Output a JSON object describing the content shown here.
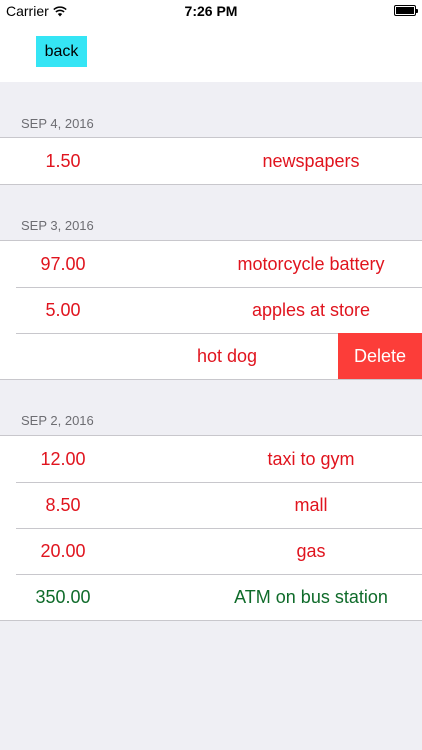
{
  "status_bar": {
    "carrier": "Carrier",
    "time": "7:26 PM"
  },
  "nav": {
    "back_label": "back"
  },
  "sections": [
    {
      "date": "SEP 4, 2016",
      "rows": [
        {
          "amount": "1.50",
          "description": "newspapers"
        }
      ]
    },
    {
      "date": "SEP 3, 2016",
      "rows": [
        {
          "amount": "97.00",
          "description": "motorcycle battery"
        },
        {
          "amount": "5.00",
          "description": "apples at store"
        },
        {
          "amount": "",
          "description": "hot dog",
          "action": "Delete"
        }
      ]
    },
    {
      "date": "SEP 2, 2016",
      "rows": [
        {
          "amount": "12.00",
          "description": "taxi to gym"
        },
        {
          "amount": "8.50",
          "description": "mall"
        },
        {
          "amount": "20.00",
          "description": "gas"
        },
        {
          "amount": "350.00",
          "description": "ATM on bus station"
        }
      ]
    }
  ],
  "colors": {
    "expense": "#e0141e",
    "income": "#0f6b2a",
    "back_button": "#35e5f5",
    "delete": "#fc3d39"
  },
  "icons": {
    "signal": "wifi-icon",
    "battery": "battery-icon"
  }
}
